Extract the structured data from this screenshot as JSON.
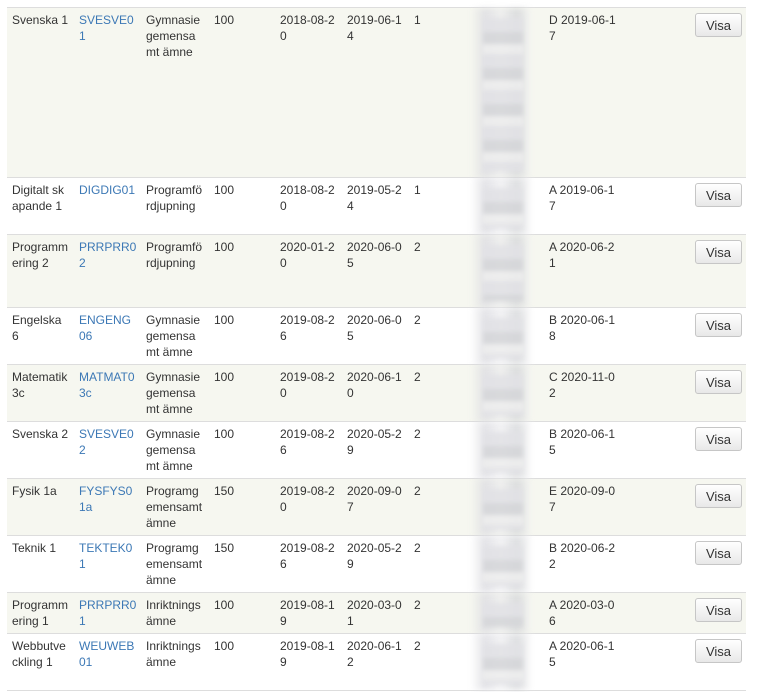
{
  "rows": [
    {
      "course": "Svenska 1",
      "code": "SVESVE01",
      "subject": "Gymnasiegemensamt ämne",
      "points": "100",
      "start": "2018-08-20",
      "end": "2019-06-14",
      "period": "1",
      "grade": "D 2019-06-17",
      "button": "Visa"
    },
    {
      "course": "Digitalt skapande 1",
      "code": "DIGDIG01",
      "subject": "Programfördjupning",
      "points": "100",
      "start": "2018-08-20",
      "end": "2019-05-24",
      "period": "1",
      "grade": "A 2019-06-17",
      "button": "Visa"
    },
    {
      "course": "Programmering 2",
      "code": "PRRPRR02",
      "subject": "Programfördjupning",
      "points": "100",
      "start": "2020-01-20",
      "end": "2020-06-05",
      "period": "2",
      "grade": "A 2020-06-21",
      "button": "Visa"
    },
    {
      "course": "Engelska 6",
      "code": "ENGENG06",
      "subject": "Gymnasiegemensamt ämne",
      "points": "100",
      "start": "2019-08-26",
      "end": "2020-06-05",
      "period": "2",
      "grade": "B 2020-06-18",
      "button": "Visa"
    },
    {
      "course": "Matematik 3c",
      "code": "MATMAT03c",
      "subject": "Gymnasiegemensamt ämne",
      "points": "100",
      "start": "2019-08-20",
      "end": "2020-06-10",
      "period": "2",
      "grade": "C 2020-11-02",
      "button": "Visa"
    },
    {
      "course": "Svenska 2",
      "code": "SVESVE02",
      "subject": "Gymnasiegemensamt ämne",
      "points": "100",
      "start": "2019-08-26",
      "end": "2020-05-29",
      "period": "2",
      "grade": "B 2020-06-15",
      "button": "Visa"
    },
    {
      "course": "Fysik 1a",
      "code": "FYSFYS01a",
      "subject": "Programgemensamt ämne",
      "points": "150",
      "start": "2019-08-20",
      "end": "2020-09-07",
      "period": "2",
      "grade": "E 2020-09-07",
      "button": "Visa"
    },
    {
      "course": "Teknik 1",
      "code": "TEKTEK01",
      "subject": "Programgemensamt ämne",
      "points": "150",
      "start": "2019-08-26",
      "end": "2020-05-29",
      "period": "2",
      "grade": "B 2020-06-22",
      "button": "Visa"
    },
    {
      "course": "Programmering 1",
      "code": "PRRPRR01",
      "subject": "Inriktningsämne",
      "points": "100",
      "start": "2019-08-19",
      "end": "2020-03-01",
      "period": "2",
      "grade": "A 2020-03-06",
      "button": "Visa"
    },
    {
      "course": "Webbutveckling 1",
      "code": "WEUWEB01",
      "subject": "Inriktningsämne",
      "points": "100",
      "start": "2019-08-19",
      "end": "2020-06-12",
      "period": "2",
      "grade": "A 2020-06-15",
      "button": "Visa"
    }
  ]
}
